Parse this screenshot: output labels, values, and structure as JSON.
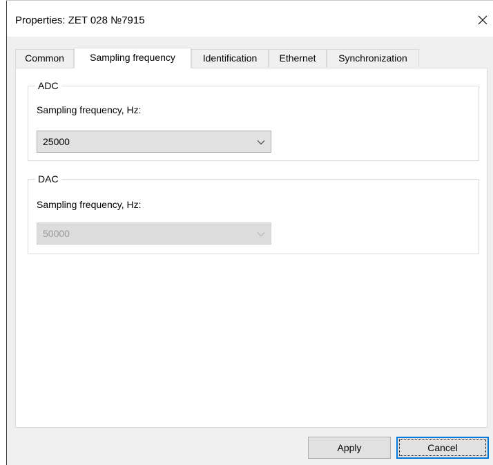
{
  "window": {
    "title": "Properties: ZET 028 №7915"
  },
  "tabs": [
    {
      "label": "Common",
      "active": false
    },
    {
      "label": "Sampling frequency",
      "active": true
    },
    {
      "label": "Identification",
      "active": false
    },
    {
      "label": "Ethernet",
      "active": false
    },
    {
      "label": "Synchronization",
      "active": false
    }
  ],
  "adc": {
    "legend": "ADC",
    "label": "Sampling frequency, Hz:",
    "value": "25000",
    "enabled": true
  },
  "dac": {
    "legend": "DAC",
    "label": "Sampling frequency, Hz:",
    "value": "50000",
    "enabled": false
  },
  "buttons": {
    "apply": "Apply",
    "cancel": "Cancel"
  },
  "colors": {
    "dialog_bg": "#f0f0f0",
    "panel_bg": "#ffffff",
    "button_bg": "#e1e1e1",
    "focus_border": "#0078d7"
  },
  "icons": {
    "close": "close-icon",
    "dropdown": "chevron-down-icon"
  }
}
